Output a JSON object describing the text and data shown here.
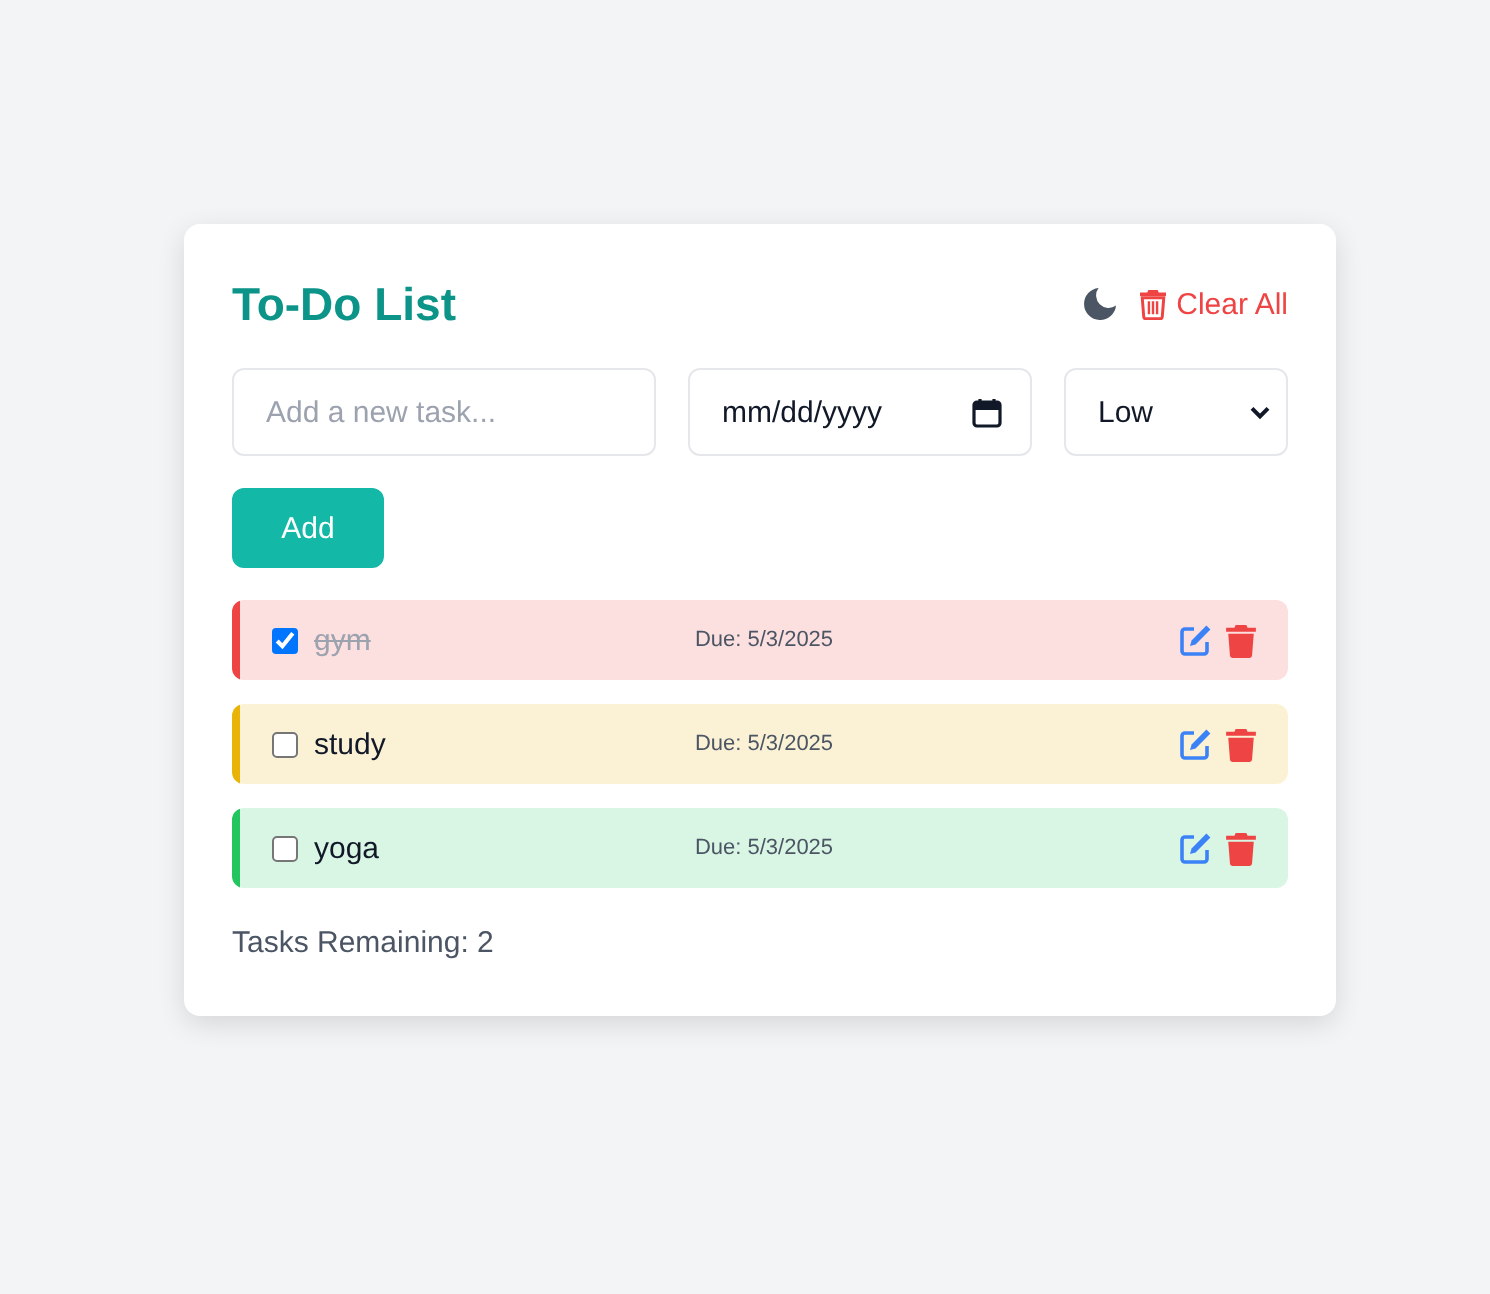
{
  "header": {
    "title": "To-Do List",
    "clear_button": "Clear All"
  },
  "form": {
    "task_input": {
      "placeholder": "Add a new task..."
    },
    "date_input": {
      "placeholder": "mm/dd/yyyy"
    },
    "priority_select": {
      "value": "Low"
    },
    "add_button": "Add"
  },
  "tasks": [
    {
      "text": "gym",
      "due": "Due: 5/3/2025",
      "checked": true,
      "color": "#ef4444"
    },
    {
      "text": "study",
      "due": "Due: 5/3/2025",
      "checked": false,
      "color": "#eab308"
    },
    {
      "text": "yoga",
      "due": "Due: 5/3/2025",
      "checked": false,
      "color": "#22c55e"
    }
  ],
  "footer": {
    "text": "Tasks Remaining: 2"
  }
}
